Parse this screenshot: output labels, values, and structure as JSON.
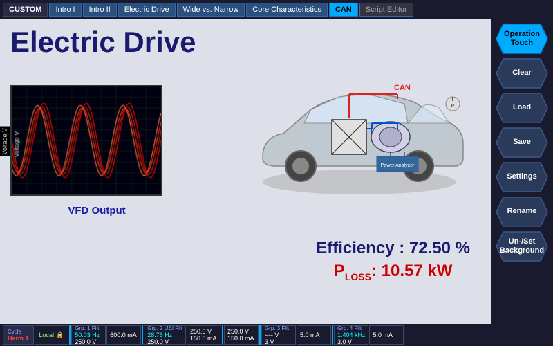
{
  "nav": {
    "custom_label": "CUSTOM",
    "tabs": [
      {
        "label": "Intro I",
        "active": false
      },
      {
        "label": "Intro II",
        "active": false
      },
      {
        "label": "Electric Drive",
        "active": false
      },
      {
        "label": "Wide vs. Narrow",
        "active": false
      },
      {
        "label": "Core Characteristics",
        "active": false
      },
      {
        "label": "CAN",
        "active": true
      },
      {
        "label": "Script Editor",
        "active": false
      }
    ]
  },
  "main": {
    "title": "Electric Drive",
    "oscilloscope": {
      "label": "Voltage V",
      "vfd_label": "VFD Output"
    },
    "efficiency": {
      "label": "Efficiency : 72.50 %",
      "ploss_label": "P",
      "ploss_sub": "LOSS",
      "ploss_value": ": 10.57 kW"
    }
  },
  "sidebar": {
    "buttons": [
      {
        "label": "Operation\nTouch",
        "active": true
      },
      {
        "label": "Clear",
        "active": false
      },
      {
        "label": "Load",
        "active": false
      },
      {
        "label": "Save",
        "active": false
      },
      {
        "label": "Settings",
        "active": false
      },
      {
        "label": "Rename",
        "active": false
      },
      {
        "label": "Un-/Set\nBackground",
        "active": false
      }
    ]
  },
  "bottom_bar": {
    "cycle_label": "Cycle",
    "cycle_value": "Harm 1",
    "local_label": "Local",
    "groups": [
      {
        "title": "Grp. 1 Filt",
        "lines": [
          "50.03  Hz",
          "250.0  V",
          "600.0  mA"
        ]
      },
      {
        "title": "Grp. 2 UΔI  Filt",
        "lines": [
          "28.76  Hz",
          "250.0  V",
          "150.0  mA"
        ]
      },
      {
        "title": "",
        "lines": [
          "250.0  V",
          "250.0  V",
          "150.0  mA"
        ]
      },
      {
        "title": "Grp. 3 Filt",
        "lines": [
          "----  V",
          "3  V",
          "5.0  mA"
        ]
      },
      {
        "title": "Grp. 4 Filt",
        "lines": [
          "1.404  kHz",
          "3.0  V",
          "5.0  mA"
        ]
      }
    ]
  }
}
